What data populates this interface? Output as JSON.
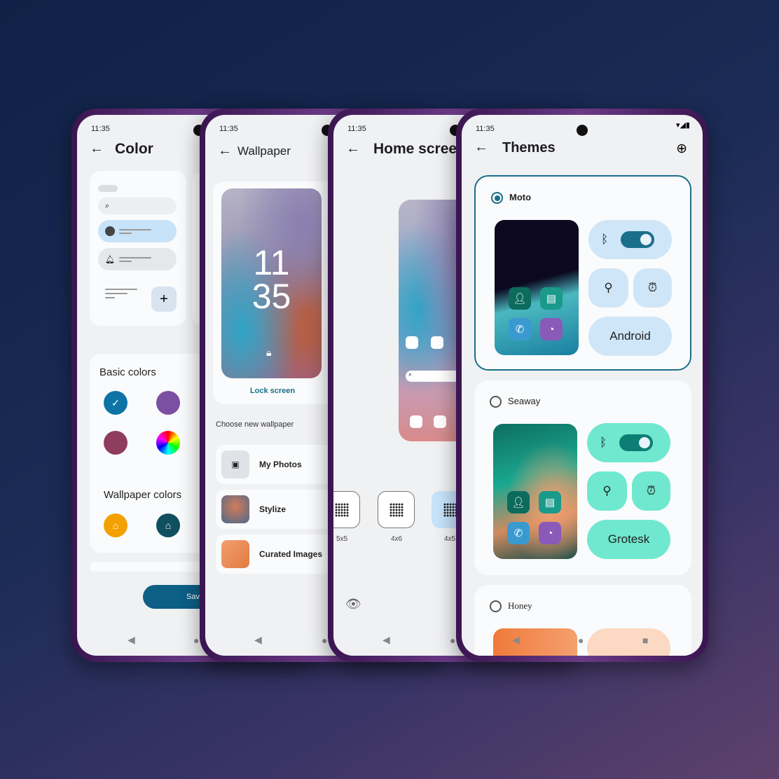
{
  "status_time": "11:35",
  "color_screen": {
    "title": "Color",
    "basic_colors_label": "Basic colors",
    "wallpaper_colors_label": "Wallpaper colors",
    "basic_colors": [
      "#0e74a6",
      "#7b4fa2",
      "#8f3d5e",
      "conic"
    ],
    "wallpaper_colors": [
      "#f2a100",
      "#0f4f5e"
    ],
    "save_label": "Save",
    "selected_color": "#0e74a6"
  },
  "wallpaper_screen": {
    "title": "Wallpaper",
    "clock_hour": "11",
    "clock_min": "35",
    "lock_screen_label": "Lock screen",
    "choose_label": "Choose new wallpaper",
    "options": [
      {
        "label": "My Photos"
      },
      {
        "label": "Stylize"
      },
      {
        "label": "Curated Images"
      }
    ]
  },
  "home_screen": {
    "title": "Home screen",
    "grids": [
      {
        "label": "5x5"
      },
      {
        "label": "4x6"
      },
      {
        "label": "4x5",
        "selected": true
      }
    ]
  },
  "themes_screen": {
    "title": "Themes",
    "themes": [
      {
        "name": "Moto",
        "selected": true,
        "font_sample": "Android",
        "accent": "#1a6f8a",
        "tile": "#cfe6f8"
      },
      {
        "name": "Seaway",
        "selected": false,
        "font_sample": "Grotesk",
        "accent": "#0d7e73",
        "tile": "#6fe8cf"
      },
      {
        "name": "Honey",
        "selected": false,
        "accent": "#f07a3a",
        "tile": "#fcd9c2"
      }
    ]
  }
}
